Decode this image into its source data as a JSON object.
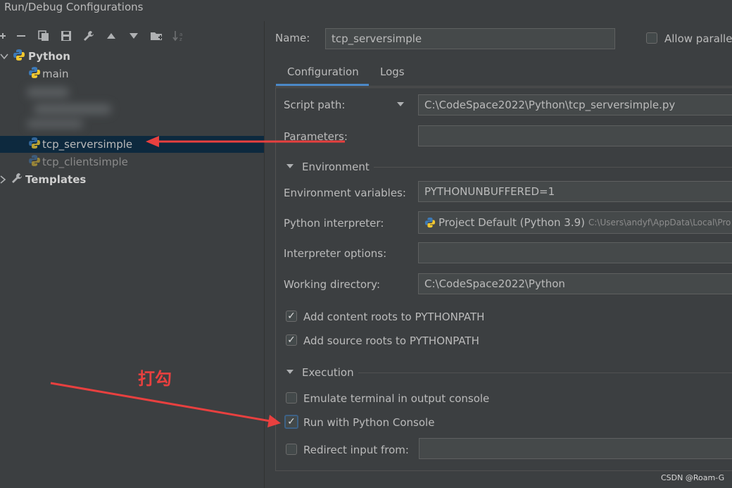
{
  "window": {
    "title": "Run/Debug Configurations"
  },
  "toolbar": {
    "icons": [
      "add-icon",
      "remove-icon",
      "copy-icon",
      "save-icon",
      "wrench-icon",
      "move-up-icon",
      "move-down-icon",
      "folder-add-icon",
      "sort-icon"
    ]
  },
  "tree": {
    "python_group": "Python",
    "items": [
      {
        "label": "main"
      },
      {
        "label": "tcp_serversimple",
        "selected": true
      },
      {
        "label": "tcp_clientsimple"
      }
    ],
    "templates": "Templates"
  },
  "form": {
    "name_label": "Name:",
    "name_value": "tcp_serversimple",
    "allow_parallel_label": "Allow parallel",
    "tabs": [
      "Configuration",
      "Logs"
    ],
    "script_path_label": "Script path:",
    "script_path_value": "C:\\CodeSpace2022\\Python\\tcp_serversimple.py",
    "parameters_label": "Parameters:",
    "parameters_value": "",
    "environment_section": "Environment",
    "env_vars_label": "Environment variables:",
    "env_vars_value": "PYTHONUNBUFFERED=1",
    "interpreter_label": "Python interpreter:",
    "interpreter_value": "Project Default (Python 3.9)",
    "interpreter_path": "C:\\Users\\andyf\\AppData\\Local\\Pro",
    "interp_options_label": "Interpreter options:",
    "interp_options_value": "",
    "working_dir_label": "Working directory:",
    "working_dir_value": "C:\\CodeSpace2022\\Python",
    "add_content_roots": "Add content roots to PYTHONPATH",
    "add_source_roots": "Add source roots to PYTHONPATH",
    "execution_section": "Execution",
    "emulate_terminal": "Emulate terminal in output console",
    "run_python_console": "Run with Python Console",
    "redirect_input": "Redirect input from:",
    "redirect_value": ""
  },
  "annotation": {
    "text": "打勾",
    "color": "#e8403f"
  },
  "watermark": "CSDN @Roam-G"
}
